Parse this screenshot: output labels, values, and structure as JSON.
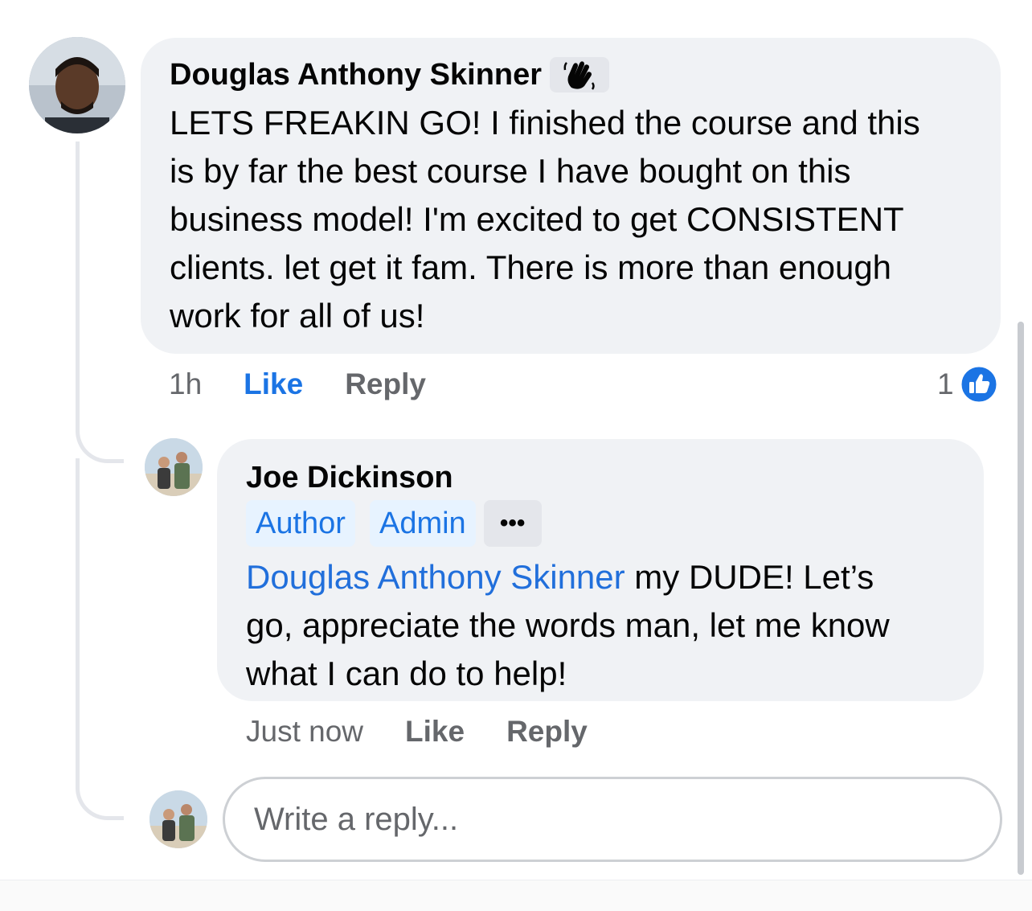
{
  "comment": {
    "author": "Douglas Anthony Skinner",
    "badge_icon": "wave-icon",
    "text_lines": [
      "LETS FREAKIN GO! I finished the course and this",
      "is by far the best course I have bought on this",
      "business model! I'm excited to get CONSISTENT",
      "clients. let get it fam. There is more than enough",
      "work for all of us!"
    ],
    "time": "1h",
    "like_label": "Like",
    "reply_label": "Reply",
    "reaction_count": "1",
    "reaction_icon": "like-icon"
  },
  "reply": {
    "author": "Joe Dickinson",
    "badges": [
      "Author",
      "Admin"
    ],
    "more_label": "•••",
    "mention": "Douglas Anthony Skinner",
    "text_after_mention": " my DUDE! Let’s",
    "text_lines": [
      "go, appreciate the words man, let me know",
      "what I can do to help!"
    ],
    "time": "Just now",
    "like_label": "Like",
    "reply_label": "Reply"
  },
  "composer": {
    "placeholder": "Write a reply..."
  },
  "colors": {
    "bubble": "#f0f2f5",
    "accent": "#1b74e4",
    "muted": "#65676b"
  }
}
